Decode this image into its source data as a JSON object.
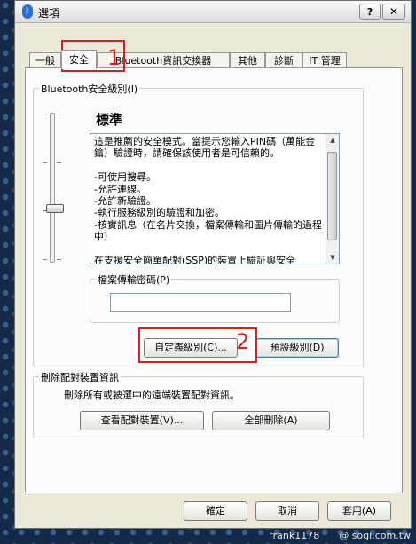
{
  "window": {
    "title": "選項",
    "help_label": "?",
    "close_label": "✕"
  },
  "tabs": [
    {
      "label": "一般"
    },
    {
      "label": "安全"
    },
    {
      "label": "Bluetooth資訊交換器"
    },
    {
      "label": "其他"
    },
    {
      "label": "診斷"
    },
    {
      "label": "IT 管理"
    }
  ],
  "security_group": {
    "legend": "Bluetooth安全級別(I)",
    "level_name": "標準",
    "description": "這是推薦的安全模式。當提示您輸入PIN碼（萬能金鑰）驗證時，請確保該使用者是可信賴的。\n\n-可使用搜尋。\n-允許連線。\n-允許新驗證。\n-執行服務級別的驗證和加密。\n-核實訊息（在名片交換，檔案傳輸和圖片傳輸的過程中）\n\n在支援安全簡單配對(SSP)的裝置上驗証與安全",
    "password_legend": "檔案傳輸密碼(P)",
    "password_value": "",
    "custom_button": "自定義級別(C)...",
    "default_button": "預設級別(D)"
  },
  "pairing_group": {
    "legend": "刪除配對裝置資訊",
    "description": "刪除所有或被選中的遠端裝置配對資訊。",
    "view_button": "查看配對裝置(V)...",
    "delete_all_button": "全部刪除(A)"
  },
  "footer": {
    "ok": "確定",
    "cancel": "取消",
    "apply": "套用(A)"
  },
  "annotations": {
    "one": "1",
    "two": "2"
  },
  "watermark": "frank1178　　@ sogi.com.tw",
  "colors": {
    "annotation_red": "#d42020",
    "panel_bg": "#fcfcfe",
    "window_bg": "#ece9d8"
  }
}
